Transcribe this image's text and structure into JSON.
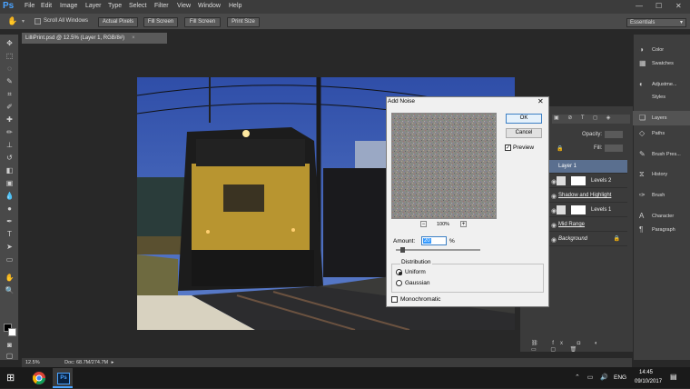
{
  "app": {
    "logo": "Ps"
  },
  "menu": [
    "File",
    "Edit",
    "Image",
    "Layer",
    "Type",
    "Select",
    "Filter",
    "View",
    "Window",
    "Help"
  ],
  "window_controls": [
    "—",
    "☐",
    "✕"
  ],
  "options_bar": {
    "scroll_all_windows": "Scroll All Windows",
    "buttons": [
      "Actual Pixels",
      "Fill Screen",
      "Fill Screen",
      "Print Size"
    ],
    "workspace": "Essentials"
  },
  "document": {
    "tab_title": "LilliPrint.psd @ 12.5% (Layer 1, RGB/8#)",
    "zoom": "12.5%",
    "doc_size": "Doc: 68.7M/274.7M"
  },
  "collapsed_panels": {
    "group1": [
      "Color",
      "Swatches"
    ],
    "group2": [
      "Adjustme...",
      "Styles"
    ],
    "group3": [
      "Layers",
      "Paths",
      "Brush Pres...",
      "History",
      "Brush",
      "Character",
      "Paragraph"
    ]
  },
  "layers_panel": {
    "opacity_label": "Opacity:",
    "fill_label": "Fill:",
    "layers": [
      {
        "name": "Layer 1",
        "selected": true
      },
      {
        "name": "Levels 2",
        "selected": false
      },
      {
        "name": "Shadow and Highlight",
        "selected": false
      },
      {
        "name": "Levels 1",
        "selected": false
      },
      {
        "name": "Mid Range",
        "selected": false
      },
      {
        "name": "Background",
        "selected": false
      }
    ],
    "bottom_icons": [
      "link-icon",
      "fx-icon",
      "mask-icon",
      "adjustment-icon",
      "folder-icon",
      "new-layer-icon",
      "trash-icon"
    ]
  },
  "dialog": {
    "title": "Add Noise",
    "ok": "OK",
    "cancel": "Cancel",
    "preview": "Preview",
    "preview_checked": true,
    "zoom_minus": "−",
    "zoom_level": "100%",
    "zoom_plus": "+",
    "amount_label": "Amount:",
    "amount_value": "20",
    "amount_unit": "%",
    "amount_slider_fraction": 0.05,
    "distribution_label": "Distribution",
    "uniform": "Uniform",
    "gaussian": "Gaussian",
    "selected_distribution": "Uniform",
    "monochromatic": "Monochromatic",
    "monochromatic_checked": false
  },
  "taskbar": {
    "language": "ENG",
    "time": "14:45",
    "date": "09/10/2017"
  },
  "colors": {
    "accent": "#4aa3ff",
    "selection": "#5a6f8f"
  }
}
